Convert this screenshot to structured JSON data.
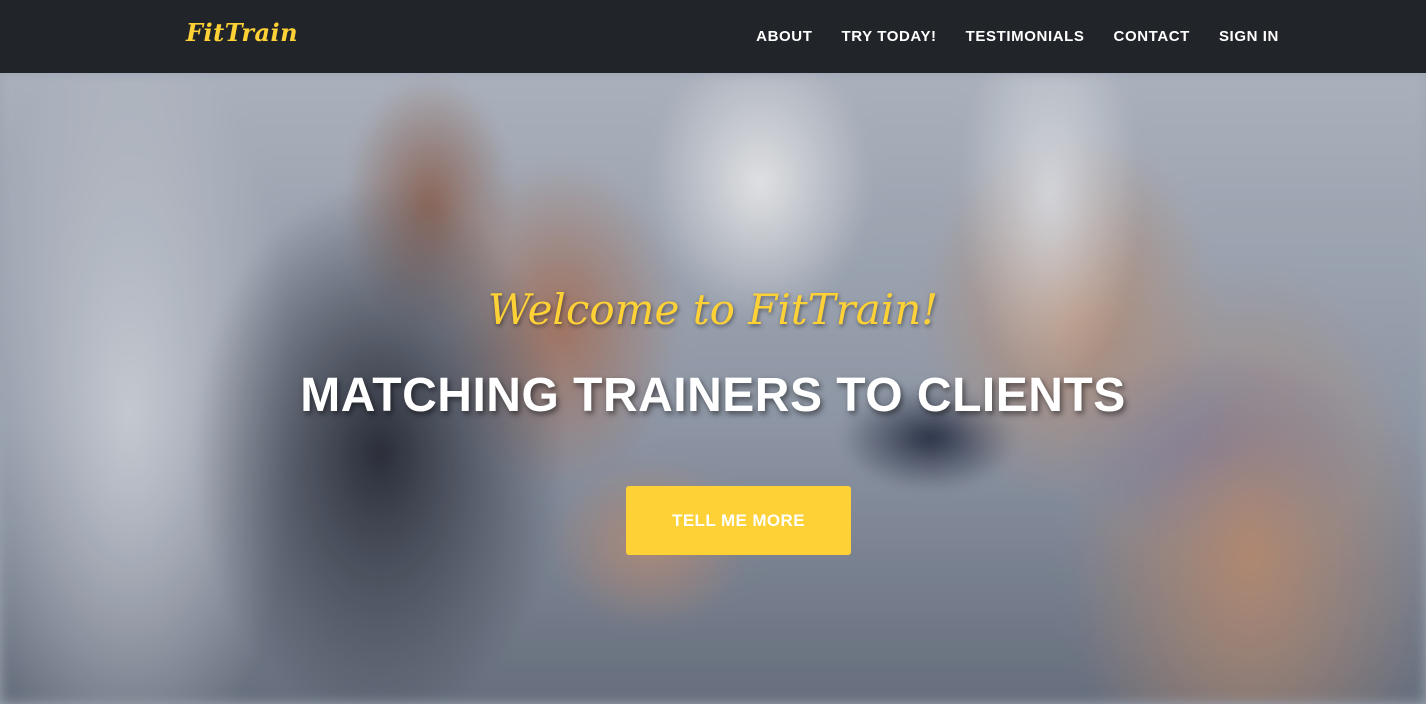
{
  "navbar": {
    "brand": "FitTrain",
    "links": [
      {
        "label": "ABOUT"
      },
      {
        "label": "TRY TODAY!"
      },
      {
        "label": "TESTIMONIALS"
      },
      {
        "label": "CONTACT"
      },
      {
        "label": "SIGN IN"
      }
    ]
  },
  "hero": {
    "lead_in": "Welcome to FitTrain!",
    "heading": "MATCHING TRAINERS TO CLIENTS",
    "cta_label": "TELL ME MORE"
  },
  "colors": {
    "accent": "#fed136",
    "navbar_bg": "#212529",
    "nav_text": "#ffffff"
  }
}
